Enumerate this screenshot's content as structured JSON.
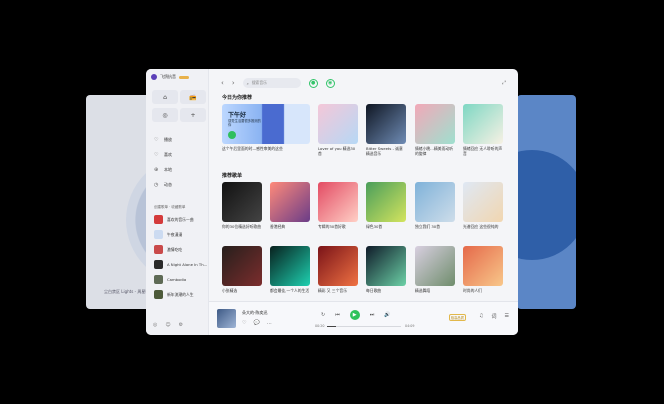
{
  "background": {
    "left_caption": "尘白禁区 Lights - 周星驰"
  },
  "sidebar": {
    "brand": "飞鸽抗音",
    "top_buttons": {
      "home": "⌂",
      "radio": "📻",
      "target": "◎",
      "add": "+"
    },
    "nav": [
      {
        "label": "播放",
        "icon": "♡"
      },
      {
        "label": "喜欢",
        "icon": "♡"
      },
      {
        "label": "本地",
        "icon": "⊕"
      },
      {
        "label": "动态",
        "icon": "◷"
      }
    ],
    "playlist_header": "创建歌单 · 收藏歌单",
    "playlists": [
      {
        "label": "喜欢的音乐一曲",
        "color": "#d43b3b"
      },
      {
        "label": "午夜漫漫",
        "color": "#ccdbf1"
      },
      {
        "label": "激情吃吃",
        "color": "#c94a4a"
      },
      {
        "label": "A Night Alone In Th…",
        "color": "#2a2a2a"
      },
      {
        "label": "Cambodia",
        "color": "#5e6a55"
      },
      {
        "label": "新年流潮的人生",
        "color": "#4d5a3a"
      }
    ],
    "bottom_icons": [
      "◎",
      "☺",
      "⚙"
    ]
  },
  "main": {
    "search_placeholder": "搜索音乐",
    "daily_title": "今日为你推荐",
    "daily": [
      {
        "title": "这个午后里面的时—感性审美的这些",
        "big": true,
        "overlay_title": "下午好",
        "overlay_sub": "感觉生活要很多推测的你"
      },
      {
        "title": "Lover of you 精选30首",
        "colors": [
          "#f4c7d8",
          "#b6d8f5"
        ]
      },
      {
        "title": "Bitter Sweets - 诚意精选音乐",
        "colors": [
          "#0f1623",
          "#6f8cb5"
        ]
      },
      {
        "title": "情绪小晚…精美而动听的旋律",
        "colors": [
          "#f2a8b8",
          "#9ee0cf"
        ]
      },
      {
        "title": "情绪回应 无人聆听的声音",
        "colors": [
          "#7ed7c3",
          "#f7f1e4"
        ]
      }
    ],
    "songlist_title": "推荐歌单",
    "songlists": [
      {
        "title": "你的30位精选好听歌曲",
        "colors": [
          "#111",
          "#444"
        ]
      },
      {
        "title": "香港经典",
        "colors": [
          "#ff8a7a",
          "#6a3c88"
        ]
      },
      {
        "title": "专辑的30首好歌",
        "colors": [
          "#e34b63",
          "#ffd0c6"
        ]
      },
      {
        "title": "绿色30首",
        "colors": [
          "#4a9e5b",
          "#d4e45e"
        ]
      },
      {
        "title": "独立我们 30首",
        "colors": [
          "#7fb2d9",
          "#ceddea"
        ]
      },
      {
        "title": "光谱回应 这些很纯的",
        "colors": [
          "#dfe8f4",
          "#f1d6b0"
        ]
      },
      {
        "title": "小张精选",
        "colors": [
          "#261f1c",
          "#7c2d2d"
        ]
      },
      {
        "title": "都会最佳,一个人的生活",
        "colors": [
          "#08201e",
          "#1ed0b0"
        ]
      },
      {
        "title": "精彩 又 三个音乐",
        "colors": [
          "#7a1318",
          "#f07243"
        ]
      },
      {
        "title": "每日歌曲",
        "colors": [
          "#0f1a29",
          "#6cd1a7"
        ]
      },
      {
        "title": "精选舞蹈",
        "colors": [
          "#d8cfe0",
          "#6f8d6c"
        ]
      },
      {
        "title": "时尚的人们",
        "colors": [
          "#e5694a",
          "#f8c78a"
        ]
      }
    ]
  },
  "player": {
    "title": "朵大的-陈奕迅",
    "current_time": "00:20",
    "total_time": "04:09",
    "progress": 0.12,
    "quality": "极高品质",
    "icons": {
      "like": "♡",
      "comment": "💬",
      "more": "…",
      "mode": "↻",
      "prev": "⏮",
      "play": "▶",
      "next": "⏭",
      "volume": "🔊",
      "eq": "♫",
      "lyrics": "词",
      "list": "☰"
    }
  }
}
